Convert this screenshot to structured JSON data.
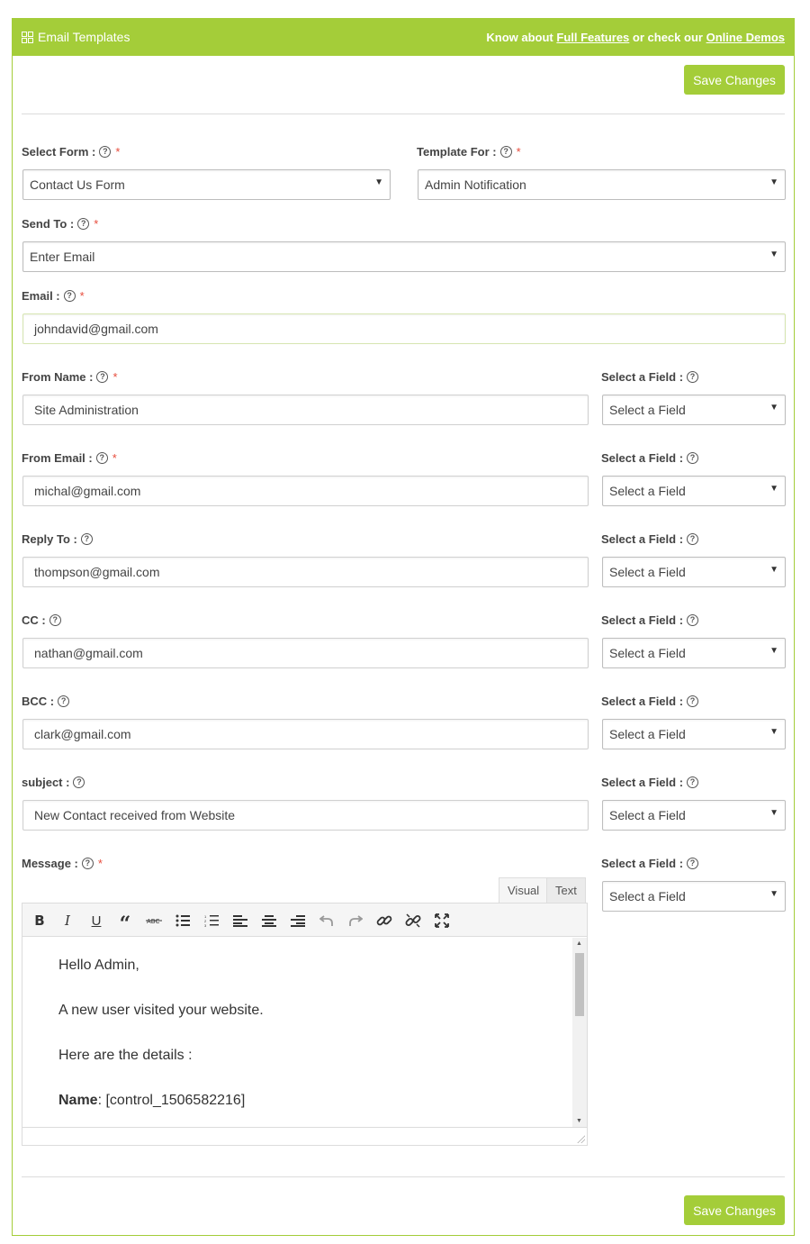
{
  "header": {
    "title": "Email Templates",
    "know_about": "Know about",
    "full_features": "Full Features",
    "or_check": "or check our",
    "online_demos": "Online Demos"
  },
  "buttons": {
    "save_top": "Save Changes",
    "save_bottom": "Save Changes"
  },
  "form": {
    "select_form": {
      "label": "Select Form :",
      "value": "Contact Us Form"
    },
    "template_for": {
      "label": "Template For :",
      "value": "Admin Notification"
    },
    "send_to": {
      "label": "Send To :",
      "value": "Enter Email"
    },
    "email": {
      "label": "Email :",
      "value": "johndavid@gmail.com"
    },
    "from_name": {
      "label": "From Name :",
      "value": "Site Administration"
    },
    "from_email": {
      "label": "From Email :",
      "value": "michal@gmail.com"
    },
    "reply_to": {
      "label": "Reply To :",
      "value": "thompson@gmail.com"
    },
    "cc": {
      "label": "CC :",
      "value": "nathan@gmail.com"
    },
    "bcc": {
      "label": "BCC :",
      "value": "clark@gmail.com"
    },
    "subject": {
      "label": "subject :",
      "value": "New Contact received from Website"
    },
    "message": {
      "label": "Message :"
    }
  },
  "select_field": {
    "label": "Select a Field :",
    "value": "Select a Field"
  },
  "help_glyph": "?",
  "required_glyph": "*",
  "dropdown_glyph": "▼",
  "editor": {
    "tabs": {
      "visual": "Visual",
      "text": "Text"
    },
    "toolbar_icons": [
      "bold-icon",
      "italic-icon",
      "underline-icon",
      "blockquote-icon",
      "strikethrough-icon",
      "bullet-list-icon",
      "numbered-list-icon",
      "align-left-icon",
      "align-center-icon",
      "align-right-icon",
      "undo-icon",
      "redo-icon",
      "link-icon",
      "unlink-icon",
      "fullscreen-icon"
    ],
    "content": {
      "line1": "Hello Admin,",
      "line2": "A new user visited your website.",
      "line3": "Here are the details :",
      "name_label": "Name",
      "name_value": ": [control_1506582216]"
    }
  },
  "colors": {
    "accent": "#a4cd39",
    "required": "#e74c3c"
  }
}
